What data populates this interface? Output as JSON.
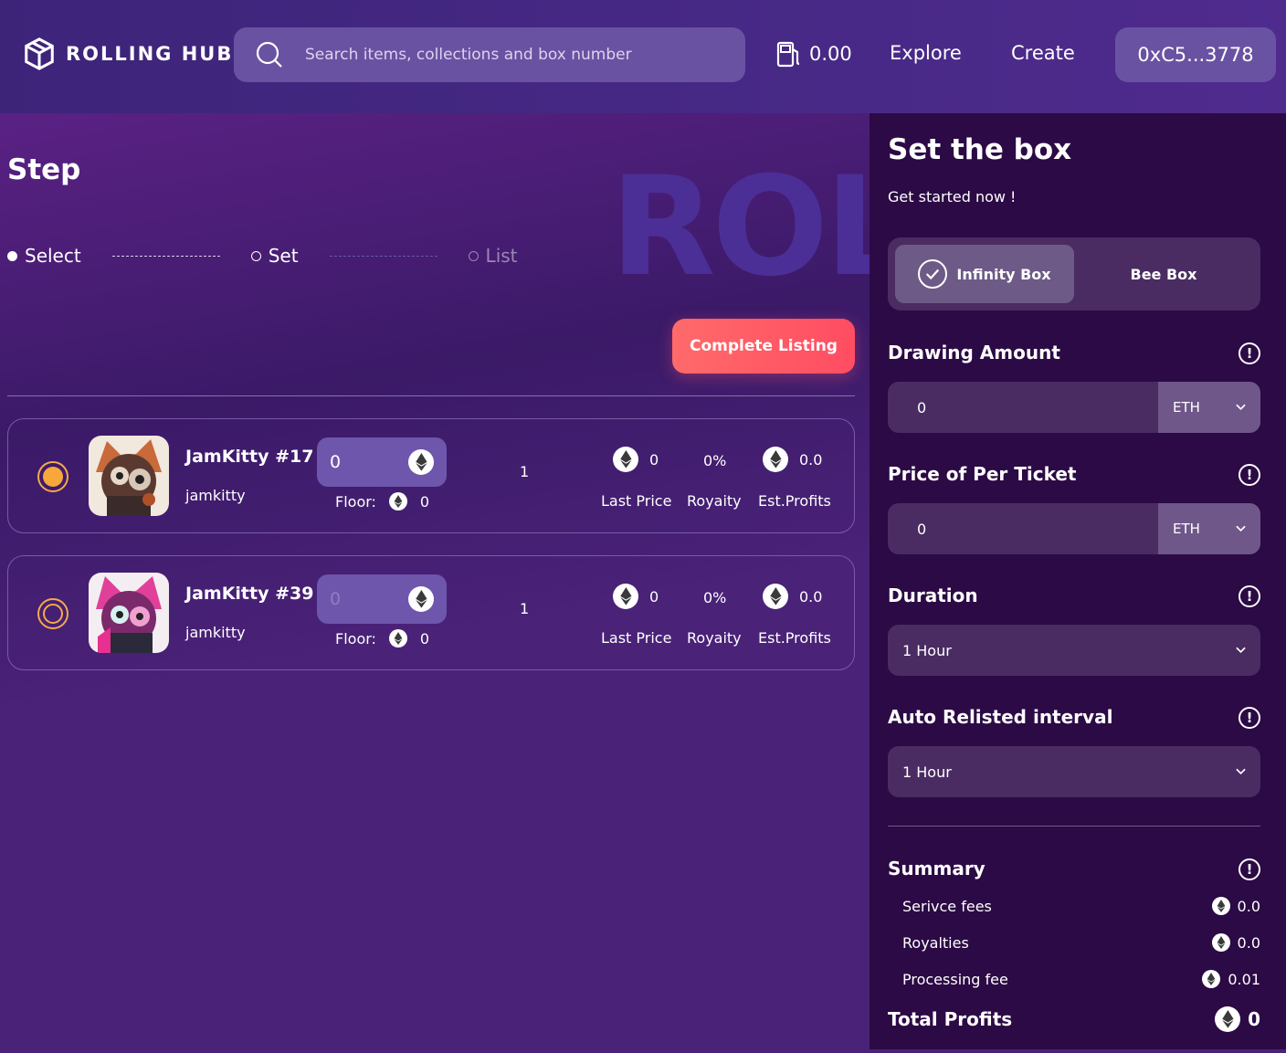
{
  "header": {
    "logo_text": "ROLLING HUB",
    "search_placeholder": "Search items, collections and box number",
    "gas_value": "0.00",
    "nav": [
      "Explore",
      "Create"
    ],
    "wallet": "0xC5...3778"
  },
  "left": {
    "watermark": "ROL",
    "title": "Step",
    "steps": [
      {
        "label": "Select",
        "state": "done"
      },
      {
        "label": "Set",
        "state": "current"
      },
      {
        "label": "List",
        "state": "pending"
      }
    ],
    "complete_button": "Complete Listing",
    "stat_labels": {
      "last_price": "Last Price",
      "royalty": "Royaity",
      "est_profits": "Est.Profits"
    },
    "floor_label": "Floor:",
    "items": [
      {
        "name": "JamKitty #17",
        "collection": "jamkitty",
        "price": "0",
        "floor": "0",
        "qty": "1",
        "last_price": "0",
        "royalty": "0%",
        "est_profits": "0.0",
        "selected": true
      },
      {
        "name": "JamKitty #39",
        "collection": "jamkitty",
        "price": "0",
        "floor": "0",
        "qty": "1",
        "last_price": "0",
        "royalty": "0%",
        "est_profits": "0.0",
        "selected": false
      }
    ]
  },
  "right": {
    "title": "Set the box",
    "subtitle": "Get started now !",
    "box_types": [
      "Infinity Box",
      "Bee Box"
    ],
    "drawing_amount": {
      "label": "Drawing Amount",
      "value": "0",
      "unit": "ETH"
    },
    "price_per_ticket": {
      "label": "Price of Per Ticket",
      "value": "0",
      "unit": "ETH"
    },
    "duration": {
      "label": "Duration",
      "value": "1 Hour"
    },
    "auto_relist": {
      "label": "Auto Relisted interval",
      "value": "1 Hour"
    },
    "summary": {
      "label": "Summary",
      "rows": [
        {
          "label": "Serivce fees",
          "value": "0.0"
        },
        {
          "label": "Royalties",
          "value": "0.0"
        },
        {
          "label": "Processing fee",
          "value": "0.01"
        }
      ],
      "total_label": "Total Profits",
      "total_value": "0"
    }
  },
  "colors": {
    "accent": "#ff5566",
    "radio": "#f8a73a",
    "panel": "#2c0a45"
  }
}
